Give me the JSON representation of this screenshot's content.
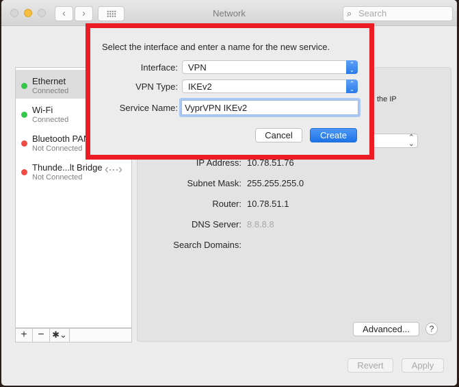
{
  "window": {
    "title": "Network",
    "search_placeholder": "Search",
    "nav": {
      "back": "‹",
      "forward": "›"
    }
  },
  "sidebar": {
    "services": [
      {
        "name": "Ethernet",
        "status": "Connected",
        "status_color": "#34c84a",
        "selected": true
      },
      {
        "name": "Wi-Fi",
        "status": "Connected",
        "status_color": "#34c84a",
        "selected": false
      },
      {
        "name": "Bluetooth PAN",
        "status": "Not Connected",
        "status_color": "#f24a45",
        "selected": false
      },
      {
        "name": "Thunde...lt Bridge",
        "status": "Not Connected",
        "status_color": "#f24a45",
        "selected": false,
        "icon": "‹···›"
      }
    ],
    "add_label": "+",
    "remove_label": "−",
    "gear_label": "✱⌄"
  },
  "detail": {
    "partial_text": "the IP",
    "rows": [
      {
        "label": "IP Address:",
        "value": "10.78.51.76",
        "dim": false
      },
      {
        "label": "Subnet Mask:",
        "value": "255.255.255.0",
        "dim": false
      },
      {
        "label": "Router:",
        "value": "10.78.51.1",
        "dim": false
      },
      {
        "label": "DNS Server:",
        "value": "8.8.8.8",
        "dim": true
      },
      {
        "label": "Search Domains:",
        "value": "",
        "dim": false
      }
    ],
    "advanced_label": "Advanced...",
    "help_label": "?"
  },
  "footer": {
    "revert_label": "Revert",
    "apply_label": "Apply"
  },
  "dialog": {
    "message": "Select the interface and enter a name for the new service.",
    "interface_label": "Interface:",
    "interface_value": "VPN",
    "vpn_type_label": "VPN Type:",
    "vpn_type_value": "IKEv2",
    "service_name_label": "Service Name:",
    "service_name_value": "VyprVPN IKEv2",
    "cancel_label": "Cancel",
    "create_label": "Create",
    "highlight_color": "#ec1c24",
    "accent_color": "#2a7ae8"
  }
}
